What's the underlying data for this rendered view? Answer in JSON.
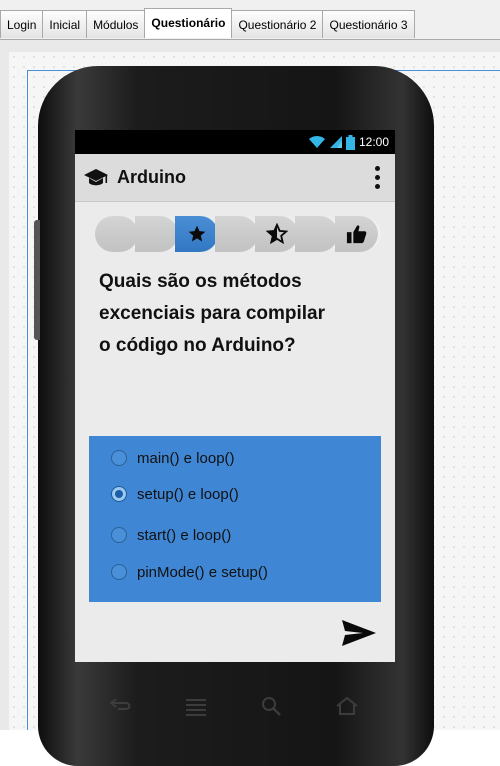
{
  "tabs": [
    {
      "label": "Login",
      "active": false
    },
    {
      "label": "Inicial",
      "active": false
    },
    {
      "label": "Módulos",
      "active": false
    },
    {
      "label": "Questionário",
      "active": true
    },
    {
      "label": "Questionário 2",
      "active": false
    },
    {
      "label": "Questionário 3",
      "active": false
    }
  ],
  "status_bar": {
    "time": "12:00",
    "icons": [
      "wifi-icon",
      "signal-icon",
      "battery-icon"
    ]
  },
  "action_bar": {
    "title": "Arduino",
    "icon": "graduation-cap-icon",
    "menu_icon": "overflow-menu-icon"
  },
  "progress_steps": [
    {
      "icon": "",
      "active": false
    },
    {
      "icon": "",
      "active": false
    },
    {
      "icon": "star-icon",
      "active": true
    },
    {
      "icon": "",
      "active": false
    },
    {
      "icon": "half-star-icon",
      "active": false
    },
    {
      "icon": "",
      "active": false
    },
    {
      "icon": "thumbs-up-icon",
      "active": false
    }
  ],
  "question": {
    "line1": "Quais são os métodos",
    "line2": "excenciais para compilar",
    "line3": "o código no Arduino?"
  },
  "options": [
    {
      "label": "main() e loop()",
      "checked": false
    },
    {
      "label": "setup() e loop()",
      "checked": true
    },
    {
      "label": "start() e loop()",
      "checked": false
    },
    {
      "label": "pinMode() e setup()",
      "checked": false
    }
  ],
  "send_icon": "send-icon",
  "hardware_keys": [
    "back-icon",
    "menu-icon",
    "search-icon",
    "home-icon"
  ],
  "colors": {
    "accent": "#3f87d4",
    "step_active": "#3a7fc8",
    "status_icon": "#33b5e5"
  }
}
